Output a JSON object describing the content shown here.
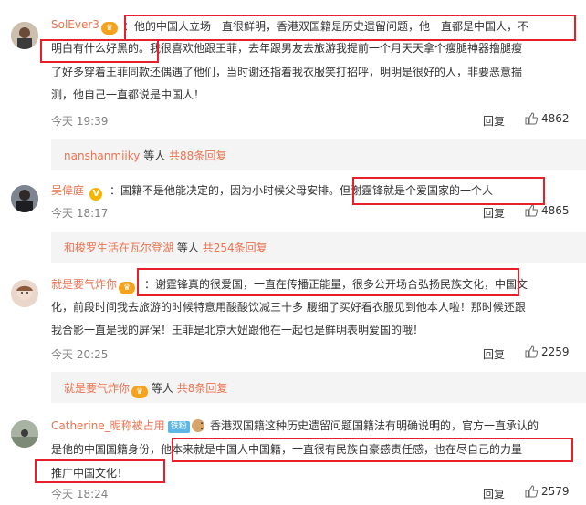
{
  "comments": [
    {
      "user": "SolEver3",
      "lines": [
        "：他的中国人立场一直很鲜明，香港双国籍是历史遗留问题，他一直都是中国人，不",
        "明白有什么好黑的。我很喜欢他跟王菲，去年跟男友去旅游我提前一个月天天拿个瘦腿神器撸腿瘦",
        "了好多穿着王菲同款还偶遇了他们，当时谢还指着我衣服笑打招呼，明明是很好的人，非要恶意揣",
        "测，他自己一直都说是中国人！"
      ],
      "time": "今天 19:39",
      "reply": "回复",
      "likes": "4862",
      "thread": {
        "who": "nanshanmiiky",
        "mid": "等人",
        "count": "共88条回复"
      }
    },
    {
      "user": "吴偉庭-",
      "lines": [
        "：国籍不是他能决定的，因为小时候父母安排。但谢霆锋就是个爱国家的一个人"
      ],
      "time": "今天 18:17",
      "reply": "回复",
      "likes": "4865",
      "thread": {
        "who": "和梭罗生活在瓦尔登湖",
        "mid": "等人",
        "count": "共254条回复"
      }
    },
    {
      "user": "就是要气炸你",
      "lines": [
        "：谢霆锋真的很爱国，一直在传播正能量，很多公开场合弘扬民族文化，中国文",
        "化，前段时间我去旅游的时候特意用酸酸饮减三十多 腰细了买好看衣服见到他本人啦！那时候还跟",
        "我合影一直是我的屏保！王菲是北京大妞跟他在一起也是鲜明表明爱国的哦！"
      ],
      "time": "今天 20:25",
      "reply": "回复",
      "likes": "2259",
      "thread": {
        "who": "就是要气炸你",
        "mid": "等人",
        "count": "共8条回复"
      }
    },
    {
      "user": "Catherine_昵称被占用",
      "badge": "铁粉",
      "lines": [
        "：香港双国籍这种历史遗留问题国籍法有明确说明的，官方一直承认的",
        "是他的中国国籍身份，他本来就是中国人中国籍，一直很有民族自豪感责任感，也在尽自己的力量",
        "推广中国文化！"
      ],
      "time": "今天 18:24",
      "reply": "回复",
      "likes": "2579"
    }
  ],
  "colors": {
    "accent": "#eb7350",
    "highlight": "#e8202b",
    "bg_thread": "#f4f4f4"
  },
  "icons": {
    "like": "thumbs-up-icon",
    "vip": "crown-badge-icon",
    "verified": "verified-v-icon"
  }
}
